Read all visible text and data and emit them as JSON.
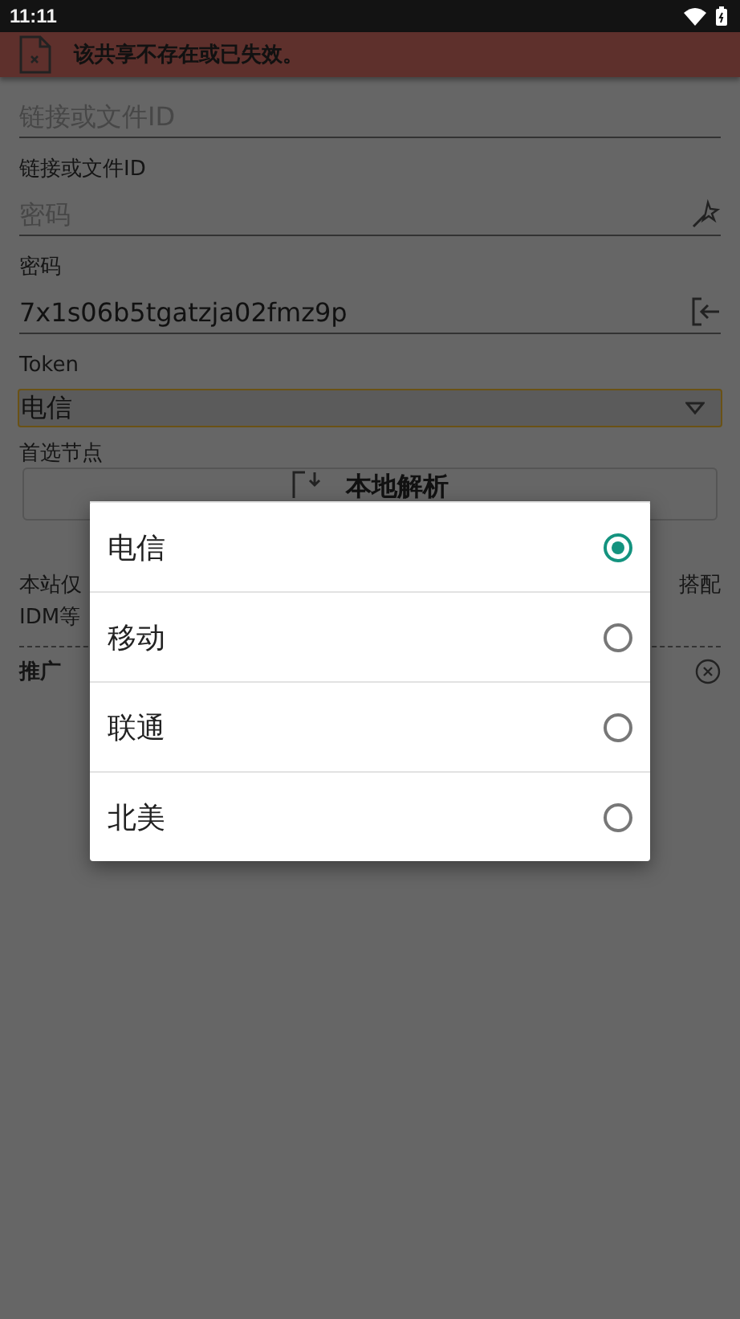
{
  "status_bar": {
    "time": "11:11"
  },
  "banner": {
    "message": "该共享不存在或已失效。"
  },
  "link_field": {
    "placeholder": "链接或文件ID"
  },
  "link_label": "链接或文件ID",
  "password_field": {
    "placeholder": "密码"
  },
  "password_label": "密码",
  "token_field": {
    "value": "7x1s06b5tgatzja02fmz9p"
  },
  "token_label": "Token",
  "node_dropdown": {
    "value": "电信"
  },
  "node_label": "首选节点",
  "parse_button": {
    "label": "本地解析"
  },
  "notice": {
    "line_1_start": "本站仅",
    "line_1_end": "搭配",
    "line_2_start": "IDM等"
  },
  "promo": {
    "title": "推广"
  },
  "dialog": {
    "options": [
      {
        "label": "电信",
        "selected": true
      },
      {
        "label": "移动",
        "selected": false
      },
      {
        "label": "联通",
        "selected": false
      },
      {
        "label": "北美",
        "selected": false
      }
    ]
  }
}
